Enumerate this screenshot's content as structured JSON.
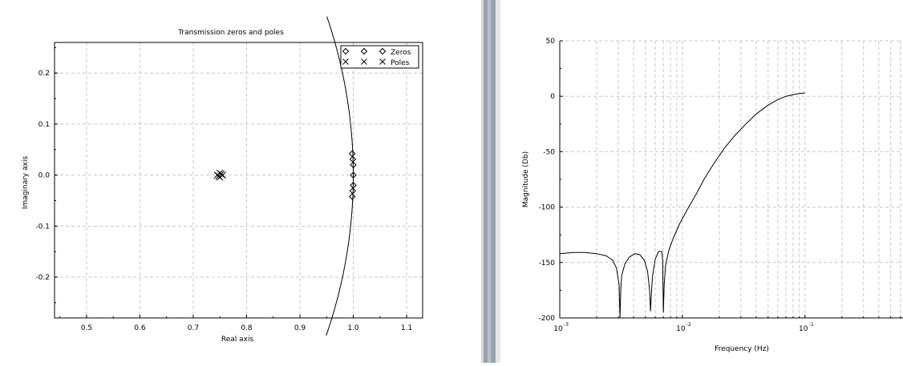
{
  "chart_data": [
    {
      "type": "scatter",
      "title": "Transmission zeros and poles",
      "xlabel": "Real axis",
      "ylabel": "Imaginary axis",
      "xlim": [
        0.44,
        1.13
      ],
      "ylim": [
        -0.28,
        0.26
      ],
      "xticks": [
        0.5,
        0.6,
        0.7,
        0.8,
        0.9,
        1.0,
        1.1
      ],
      "xtick_labels": [
        "0.5",
        "0.6",
        "0.7",
        "0.8",
        "0.9",
        "1.0",
        "1.1"
      ],
      "yticks": [
        0.2,
        0.1,
        0.0,
        -0.1,
        -0.2
      ],
      "ytick_labels": [
        "0.2",
        "0.1",
        "0.0",
        "-0.1",
        "-0.2"
      ],
      "grid": true,
      "legend": "top-right",
      "series": [
        {
          "name": "Zeros",
          "marker": "diamond",
          "points": [
            [
              0.998,
              0.042
            ],
            [
              0.999,
              0.031
            ],
            [
              1.0,
              0.02
            ],
            [
              1.0,
              0.0
            ],
            [
              1.0,
              -0.02
            ],
            [
              0.999,
              -0.031
            ],
            [
              0.998,
              -0.042
            ]
          ]
        },
        {
          "name": "Poles",
          "marker": "x",
          "points": [
            [
              0.745,
              0.0
            ],
            [
              0.75,
              0.004
            ],
            [
              0.75,
              -0.004
            ],
            [
              0.755,
              0.0
            ],
            [
              0.752,
              0.002
            ],
            [
              0.748,
              -0.002
            ]
          ]
        }
      ],
      "unit_circle": true
    },
    {
      "type": "line",
      "title": "",
      "xlabel": "Frequency (Hz)",
      "ylabel": "Magnitude (Db)",
      "xscale": "log",
      "xlim": [
        0.001,
        0.63
      ],
      "ylim": [
        -200,
        50
      ],
      "yticks": [
        50,
        0,
        -50,
        -100,
        -150,
        -200
      ],
      "ytick_labels": [
        "50",
        "0",
        "-50",
        "-100",
        "-150",
        "-200"
      ],
      "xticks": [
        0.001,
        0.01,
        0.1
      ],
      "xtick_labels": [
        {
          "base": "10",
          "exp": "-3"
        },
        {
          "base": "10",
          "exp": "-2"
        },
        {
          "base": "10",
          "exp": "-1"
        }
      ],
      "grid": true,
      "series": [
        {
          "x": [
            0.001,
            0.0013,
            0.0016,
            0.002,
            0.0024,
            0.0027,
            0.0029,
            0.00305,
            0.0031,
            0.00315,
            0.0032,
            0.0034,
            0.0037,
            0.0041,
            0.0045,
            0.0049,
            0.0052,
            0.0054,
            0.0055,
            0.0056,
            0.0057,
            0.006,
            0.0064,
            0.0068,
            0.0069,
            0.00695,
            0.007,
            0.0071,
            0.0073,
            0.0078,
            0.0085,
            0.0095,
            0.011,
            0.013,
            0.015,
            0.018,
            0.022,
            0.027,
            0.033,
            0.04,
            0.05,
            0.06,
            0.07,
            0.085,
            0.1
          ],
          "y": [
            -142,
            -141,
            -141,
            -142,
            -144,
            -148,
            -155,
            -170,
            -200,
            -172,
            -162,
            -151,
            -145,
            -142,
            -143,
            -148,
            -158,
            -175,
            -194,
            -176,
            -163,
            -147,
            -140,
            -140,
            -148,
            -170,
            -195,
            -170,
            -152,
            -138,
            -127,
            -115,
            -102,
            -88,
            -75,
            -61,
            -47,
            -35,
            -25,
            -16,
            -8,
            -3,
            0,
            2,
            3
          ]
        }
      ]
    }
  ]
}
